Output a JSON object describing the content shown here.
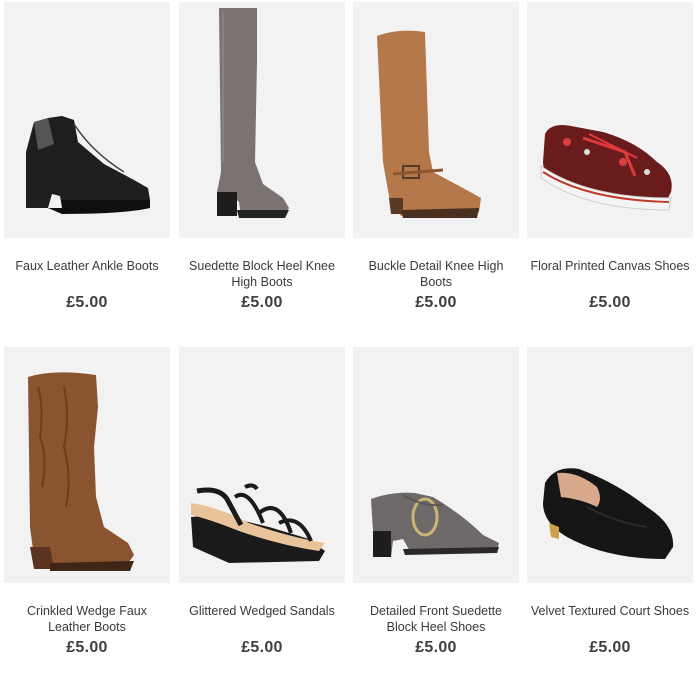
{
  "products": [
    {
      "name": "Faux Leather Ankle Boots",
      "price": "£5.00",
      "image": "black-ankle-boot"
    },
    {
      "name": "Suedette Block Heel Knee High Boots",
      "price": "£5.00",
      "image": "grey-knee-high-boot"
    },
    {
      "name": "Buckle Detail Knee High Boots",
      "price": "£5.00",
      "image": "tan-buckle-boot"
    },
    {
      "name": "Floral Printed Canvas Shoes",
      "price": "£5.00",
      "image": "floral-canvas-shoe"
    },
    {
      "name": "Crinkled Wedge Faux Leather Boots",
      "price": "£5.00",
      "image": "brown-wedge-boot"
    },
    {
      "name": "Glittered Wedged Sandals",
      "price": "£5.00",
      "image": "black-wedge-sandal"
    },
    {
      "name": "Detailed Front Suedette Block Heel Shoes",
      "price": "£5.00",
      "image": "grey-buckle-shoe"
    },
    {
      "name": "Velvet Textured Court Shoes",
      "price": "£5.00",
      "image": "black-velvet-flat"
    }
  ]
}
